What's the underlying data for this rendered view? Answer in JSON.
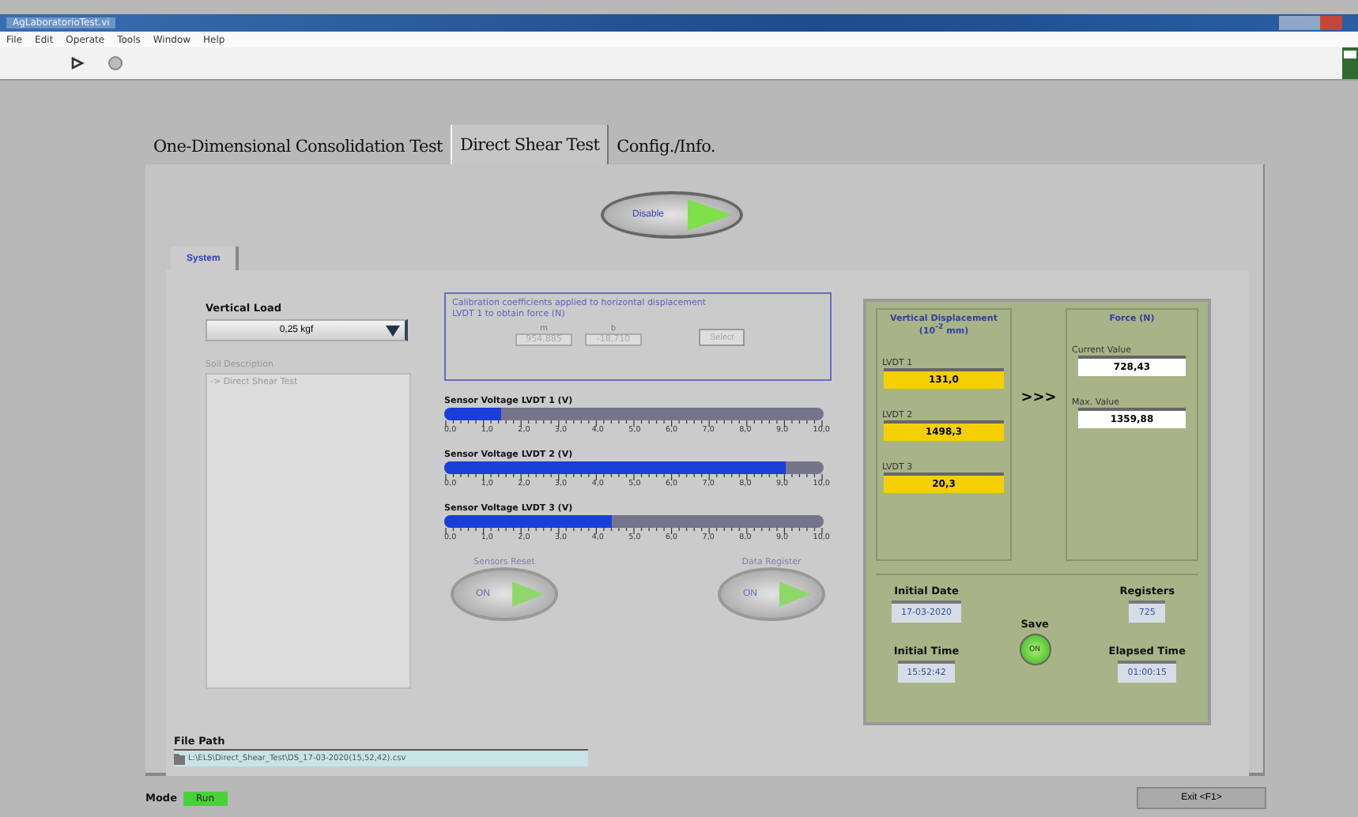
{
  "window": {
    "title": "AgLaboratorioTest.vi"
  },
  "menu": [
    "File",
    "Edit",
    "Operate",
    "Tools",
    "Window",
    "Help"
  ],
  "tabs": [
    {
      "label": "One-Dimensional Consolidation Test",
      "selected": false
    },
    {
      "label": "Direct Shear Test",
      "selected": true
    },
    {
      "label": "Config./Info.",
      "selected": false
    }
  ],
  "disable_button": {
    "label": "Disable"
  },
  "subtabs": [
    {
      "label": "System",
      "selected": true
    }
  ],
  "vertical_load": {
    "label": "Vertical Load",
    "value": "0,25 kgf"
  },
  "soil_description": {
    "label": "Soil Description",
    "value": "-> Direct Shear Test",
    "disabled": true
  },
  "calibration": {
    "text": "Calibration coefficients applied to horizontal displacement LVDT 1 to obtain force (N)",
    "disabled": true,
    "fields": [
      {
        "label": "m",
        "value": "954,885"
      },
      {
        "label": "b",
        "value": "-18,710"
      }
    ],
    "button": "Select"
  },
  "sensors": [
    {
      "label": "Sensor Voltage LVDT 1 (V)",
      "level": 0.15,
      "scale": [
        "0,0",
        "1,0",
        "2,0",
        "3,0",
        "4,0",
        "5,0",
        "6,0",
        "7,0",
        "8,0",
        "9,0",
        "10,0"
      ]
    },
    {
      "label": "Sensor Voltage LVDT 2 (V)",
      "level": 0.9,
      "scale": [
        "0,0",
        "1,0",
        "2,0",
        "3,0",
        "4,0",
        "5,0",
        "6,0",
        "7,0",
        "8,0",
        "9,0",
        "10,0"
      ]
    },
    {
      "label": "Sensor Voltage LVDT 3 (V)",
      "level": 0.44,
      "scale": [
        "0,0",
        "1,0",
        "2,0",
        "3,0",
        "4,0",
        "5,0",
        "6,0",
        "7,0",
        "8,0",
        "9,0",
        "10,0"
      ]
    }
  ],
  "toggles": [
    {
      "label": "Sensors Reset",
      "state": "ON"
    },
    {
      "label": "Data Register",
      "state": "ON"
    }
  ],
  "displacement": {
    "title": "Vertical Displacement",
    "unit": "(10$^{-2}$ mm)",
    "items": [
      {
        "label": "LVDT 1",
        "value": "131,0"
      },
      {
        "label": "LVDT 2",
        "value": "1498,3"
      },
      {
        "label": "LVDT 3",
        "value": "20,3"
      }
    ]
  },
  "arrows": ">>>",
  "force": {
    "title": "Force (N)",
    "items": [
      {
        "label": "Current Value",
        "value": "728,43"
      },
      {
        "label": "Max. Value",
        "value": "1359,88"
      }
    ]
  },
  "initial_date": {
    "label": "Initial Date",
    "value": "17-03-2020"
  },
  "initial_time": {
    "label": "Initial Time",
    "value": "15:52:42"
  },
  "save": {
    "label": "Save",
    "state": "ON",
    "on": true
  },
  "registers": {
    "label": "Registers",
    "value": "725"
  },
  "elapsed_time": {
    "label": "Elapsed Time",
    "value": "01:00:15"
  },
  "file_path": {
    "label": "File Path",
    "value": "L:\\ELS\\Direct_Shear_Test\\DS_17-03-2020(15,52,42).csv"
  },
  "mode": {
    "label": "Mode",
    "value": "Run"
  },
  "exit_button": "Exit <F1>"
}
